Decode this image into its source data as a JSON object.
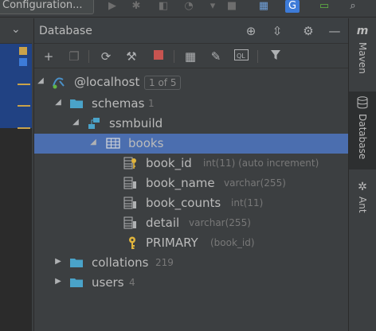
{
  "toolbar": {
    "run_config_label": "Configuration..."
  },
  "panel": {
    "title": "Database"
  },
  "tree": {
    "host": {
      "label": "@localhost",
      "badge": "1 of 5"
    },
    "schemas": {
      "label": "schemas",
      "count": "1"
    },
    "schema": {
      "label": "ssmbuild"
    },
    "table": {
      "label": "books"
    },
    "columns": [
      {
        "name": "book_id",
        "type": "int(11) (auto increment)"
      },
      {
        "name": "book_name",
        "type": "varchar(255)"
      },
      {
        "name": "book_counts",
        "type": "int(11)"
      },
      {
        "name": "detail",
        "type": "varchar(255)"
      }
    ],
    "key": {
      "name": "PRIMARY",
      "detail": "(book_id)"
    },
    "collations": {
      "label": "collations",
      "count": "219"
    },
    "users": {
      "label": "users",
      "count": "4"
    }
  },
  "right_bar": {
    "maven": "Maven",
    "database": "Database",
    "ant": "Ant"
  },
  "colors": {
    "panel_bg": "#3c3f41",
    "selection": "#4b6eaf",
    "folder": "#4aa3c9",
    "key": "#e0b43c"
  }
}
